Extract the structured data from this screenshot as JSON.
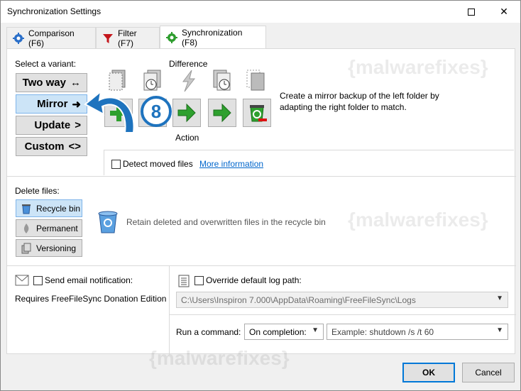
{
  "window": {
    "title": "Synchronization Settings"
  },
  "tabs": [
    {
      "label": "Comparison (F6)"
    },
    {
      "label": "Filter (F7)"
    },
    {
      "label": "Synchronization (F8)"
    }
  ],
  "variants": {
    "heading": "Select a variant:",
    "items": [
      {
        "label": "Two way",
        "symbol": "↔"
      },
      {
        "label": "Mirror",
        "symbol": "➜"
      },
      {
        "label": "Update",
        "symbol": ">"
      },
      {
        "label": "Custom",
        "symbol": "<>"
      }
    ],
    "selected": "Mirror"
  },
  "sync_config": {
    "difference_label": "Difference",
    "action_label": "Action",
    "description": "Create a mirror backup of the left folder by adapting the right folder to match.",
    "detect_moved": {
      "label": "Detect moved files",
      "checked": false
    },
    "more_info": "More information"
  },
  "annotation": {
    "step": "8"
  },
  "delete_files": {
    "heading": "Delete files:",
    "options": [
      {
        "label": "Recycle bin"
      },
      {
        "label": "Permanent"
      },
      {
        "label": "Versioning"
      }
    ],
    "selected": "Recycle bin",
    "description": "Retain deleted and overwritten files in the recycle bin"
  },
  "email": {
    "label": "Send email notification:",
    "checked": false,
    "note": "Requires FreeFileSync Donation Edition"
  },
  "log": {
    "label": "Override default log path:",
    "checked": false,
    "path": "C:\\Users\\Inspiron 7.000\\AppData\\Roaming\\FreeFileSync\\Logs"
  },
  "command": {
    "label": "Run a command:",
    "when": "On completion:",
    "placeholder": "Example: shutdown /s /t 60"
  },
  "buttons": {
    "ok": "OK",
    "cancel": "Cancel"
  },
  "watermark": "{malwarefixes}",
  "colors": {
    "accent": "#0078d7",
    "selected_bg": "#cce4f7",
    "arrow_blue": "#1e73be"
  }
}
